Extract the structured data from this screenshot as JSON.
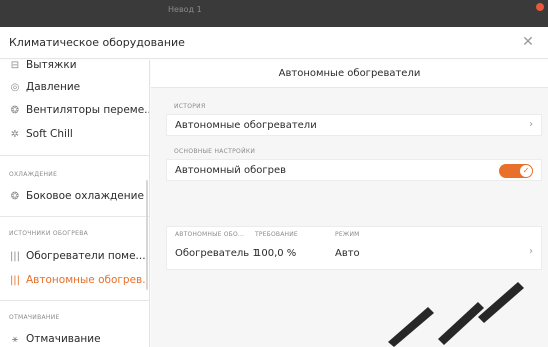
{
  "window": {
    "top_title": "Невод 1",
    "dialog_title": "Климатическое оборудование",
    "close_glyph": "✕"
  },
  "sidebar": {
    "items_top": [
      {
        "label": "Вытяжки",
        "icon": "exhaust-icon",
        "glyph": "⊟"
      },
      {
        "label": "Давление",
        "icon": "pressure-gauge-icon",
        "glyph": "◎"
      },
      {
        "label": "Вентиляторы переме...",
        "icon": "fan-icon",
        "glyph": "❂"
      },
      {
        "label": "Soft Chill",
        "icon": "soft-chill-icon",
        "glyph": "✲"
      }
    ],
    "section_cooling": "ОХЛАЖДЕНИЕ",
    "cooling_items": [
      {
        "label": "Боковое охлаждение",
        "icon": "side-cooling-icon",
        "glyph": "❂"
      }
    ],
    "section_heating": "ИСТОЧНИКИ ОБОГРЕВА",
    "heating_items": [
      {
        "label": "Обогреватели поме...",
        "icon": "heater-icon",
        "glyph": "|||",
        "active": false
      },
      {
        "label": "Автономные обогрев...",
        "icon": "heater-icon",
        "glyph": "|||",
        "active": true
      }
    ],
    "section_soaking": "ОТМАЧИВАНИЕ",
    "soaking_items": [
      {
        "label": "Отмачивание",
        "icon": "soaking-icon",
        "glyph": "⚹"
      }
    ]
  },
  "content": {
    "title": "Автономные обогреватели",
    "history_label": "ИСТОРИЯ",
    "history_row": "Автономные обогреватели",
    "basic_label": "ОСНОВНЫЕ НАСТРОЙКИ",
    "toggle_row": "Автономный обогрев",
    "toggle_on": true,
    "table": {
      "headers": [
        "АВТОНОМНЫЕ ОБО...",
        "ТРЕБОВАНИЕ",
        "РЕЖИМ"
      ],
      "rows": [
        [
          "Обогреватель 1",
          "100,0 %",
          "Авто"
        ]
      ]
    },
    "chevron": "›"
  },
  "colors": {
    "accent": "#e8702a",
    "topbar": "#3a3a3a",
    "muted": "#8a8a8a"
  }
}
